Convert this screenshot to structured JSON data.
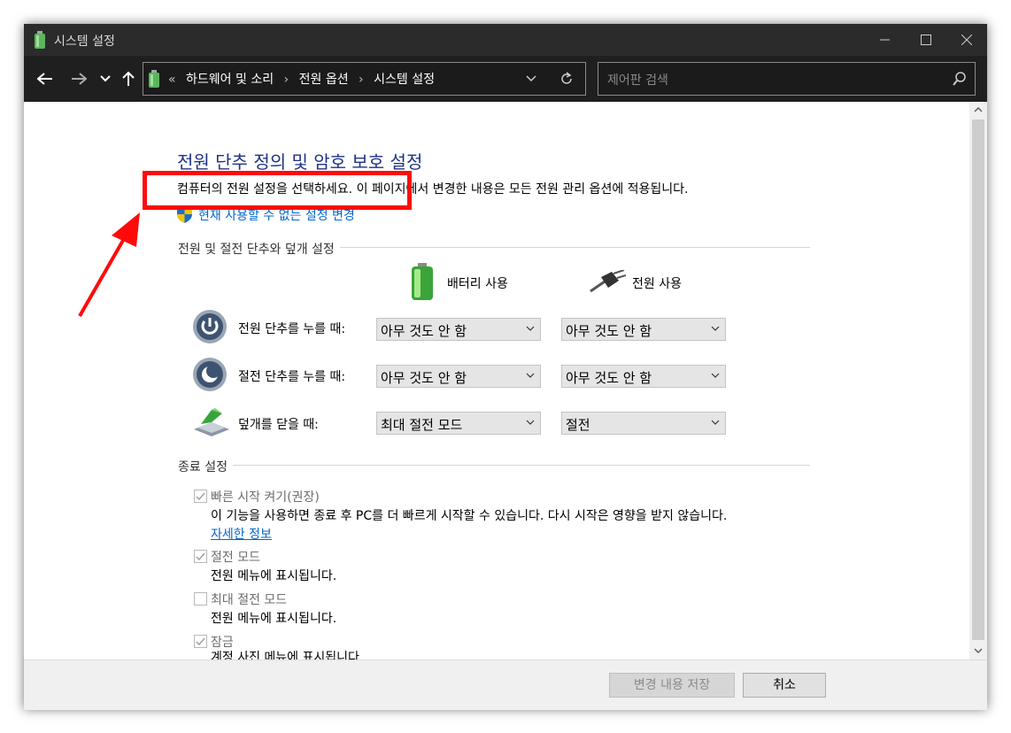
{
  "window": {
    "title": "시스템 설정"
  },
  "nav": {
    "breadcrumb_prefix": "«",
    "breadcrumbs": [
      "하드웨어 및 소리",
      "전원 옵션",
      "시스템 설정"
    ],
    "search_placeholder": "제어판 검색"
  },
  "page": {
    "title": "전원 단추 정의 및 암호 보호 설정",
    "description": "컴퓨터의 전원 설정을 선택하세요. 이 페이지에서 변경한 내용은 모든 전원 관리 옵션에 적용됩니다.",
    "admin_link": "현재 사용할 수 없는 설정 변경"
  },
  "power_buttons": {
    "section_title": "전원 및 절전 단추와 덮개 설정",
    "col_battery": "배터리 사용",
    "col_plugged": "전원 사용",
    "rows": [
      {
        "label": "전원 단추를 누를 때:",
        "battery": "아무 것도 안 함",
        "plugged": "아무 것도 안 함"
      },
      {
        "label": "절전 단추를 누를 때:",
        "battery": "아무 것도 안 함",
        "plugged": "아무 것도 안 함"
      },
      {
        "label": "덮개를 닫을 때:",
        "battery": "최대 절전 모드",
        "plugged": "절전"
      }
    ]
  },
  "shutdown": {
    "section_title": "종료 설정",
    "items": [
      {
        "label": "빠른 시작 켜기(권장)",
        "checked": true,
        "desc": "이 기능을 사용하면 종료 후 PC를 더 빠르게 시작할 수 있습니다. 다시 시작은 영향을 받지 않습니다.",
        "link": "자세한 정보"
      },
      {
        "label": "절전 모드",
        "checked": true,
        "desc": "전원 메뉴에 표시됩니다."
      },
      {
        "label": "최대 절전 모드",
        "checked": false,
        "desc": "전원 메뉴에 표시됩니다."
      },
      {
        "label": "잠금",
        "checked": true,
        "desc": "계정 사진 메뉴에 표시됩니다."
      }
    ]
  },
  "footer": {
    "save_label": "변경 내용 저장",
    "cancel_label": "취소"
  },
  "colors": {
    "annotation": "#ff0a0a",
    "link": "#0066cc",
    "heading": "#1e3287"
  }
}
